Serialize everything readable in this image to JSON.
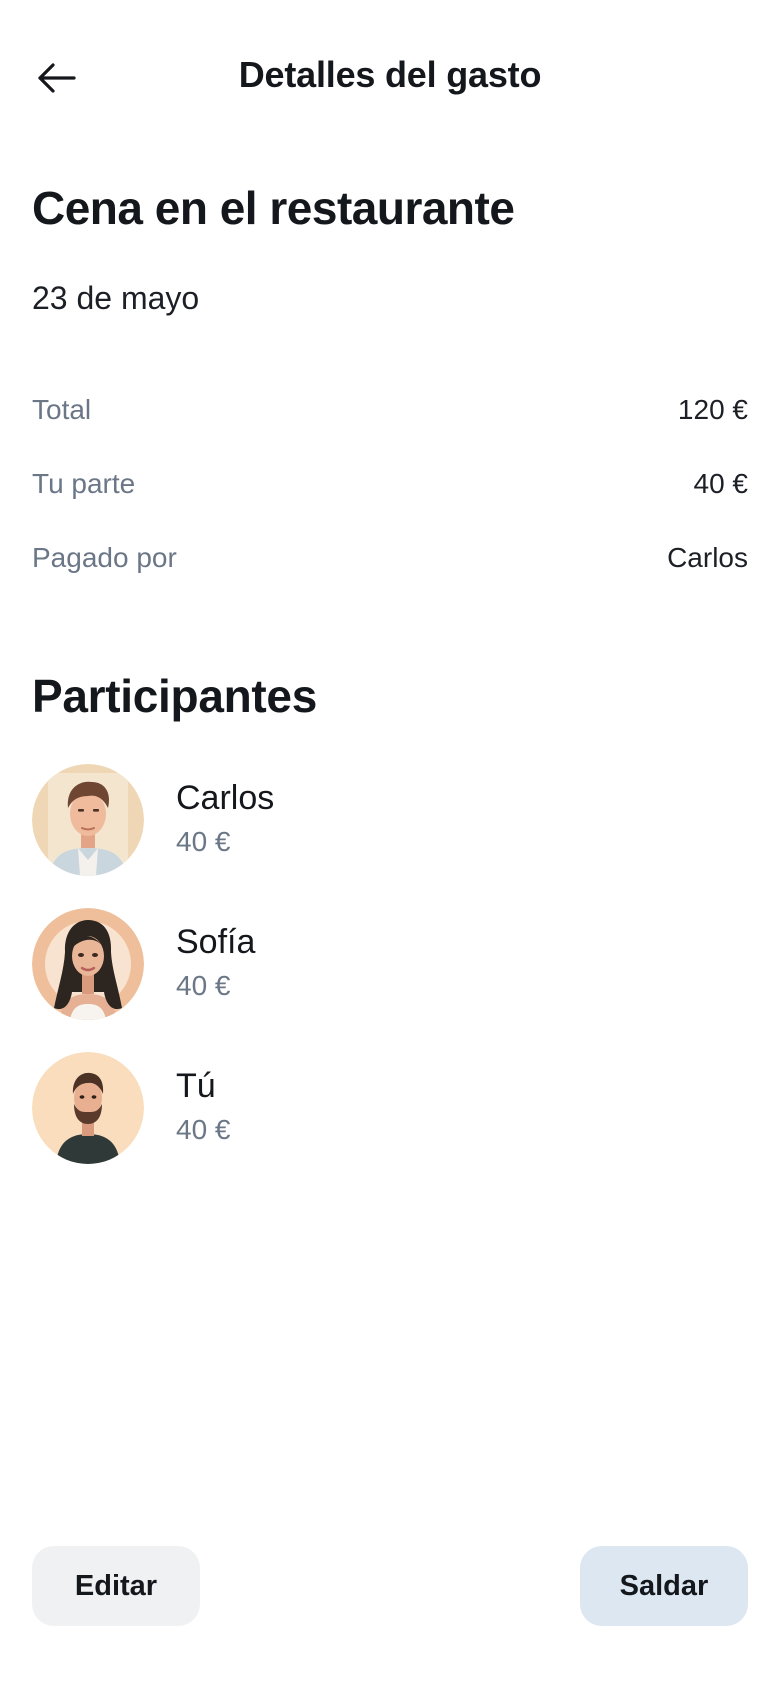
{
  "header": {
    "title": "Detalles del gasto",
    "back_icon": "arrow-left-icon"
  },
  "expense": {
    "title": "Cena en el restaurante",
    "date": "23 de mayo"
  },
  "details": [
    {
      "label": "Total",
      "value": "120 €"
    },
    {
      "label": "Tu parte",
      "value": "40 €"
    },
    {
      "label": "Pagado por",
      "value": "Carlos"
    }
  ],
  "participants_section": {
    "title": "Participantes",
    "items": [
      {
        "name": "Carlos",
        "amount": "40 €",
        "avatar": "avatar-carlos"
      },
      {
        "name": "Sofía",
        "amount": "40 €",
        "avatar": "avatar-sofia"
      },
      {
        "name": "Tú",
        "amount": "40 €",
        "avatar": "avatar-tu"
      }
    ]
  },
  "actions": {
    "edit_label": "Editar",
    "settle_label": "Saldar"
  },
  "colors": {
    "muted_text": "#6b7787",
    "edit_button_bg": "#f0f1f3",
    "settle_button_bg": "#dde7f1"
  }
}
